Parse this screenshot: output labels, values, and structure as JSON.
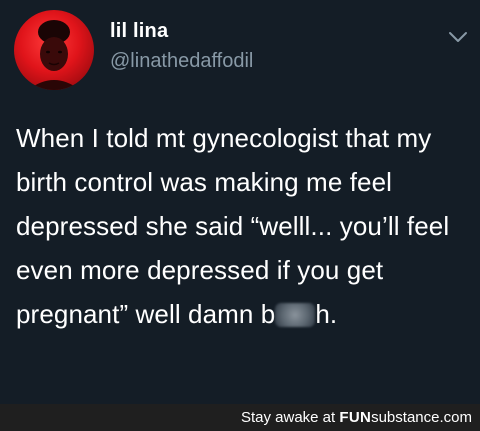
{
  "tweet": {
    "display_name": "lil lina",
    "handle": "@linathedaffodil",
    "avatar_icon": "profile-photo",
    "menu_icon": "chevron-down-icon",
    "text_before_censor": "When I told mt gynecologist that my birth control was making me feel depressed she said “welll... you’ll feel even more depressed if you get pregnant” well damn b",
    "text_after_censor": "h."
  },
  "watermark": {
    "prefix": "Stay awake at ",
    "brand_main": "FUN",
    "brand_sub": "substance",
    "brand_suffix": ".com"
  },
  "colors": {
    "background": "#141d26",
    "text": "#ffffff",
    "muted": "#8899a6",
    "watermark_bar": "#1f1f1f"
  }
}
